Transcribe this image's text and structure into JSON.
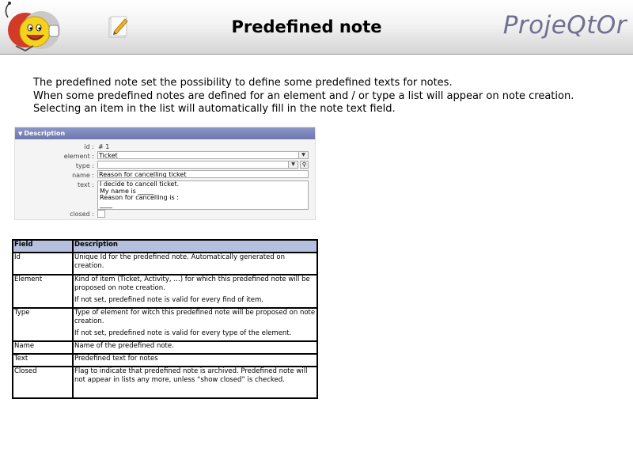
{
  "header": {
    "title": "Predefined note",
    "logo_text": "ProjeQtOr",
    "mascot_icon": "smiley-mascot-icon",
    "note_icon": "note-pencil-icon"
  },
  "intro": {
    "lines": [
      "The predefined note set the possibility to define some predefined texts for notes.",
      "When some predefined notes are defined for an element and / or type a list will appear on note creation.",
      "Selecting an item in the list will automatically fill in the note text field."
    ]
  },
  "form": {
    "section_title": "Description",
    "labels": {
      "id": "id :",
      "element": "element :",
      "type": "type :",
      "name": "name :",
      "text": "text :",
      "closed": "closed :"
    },
    "values": {
      "id": "# 1",
      "element": "Ticket",
      "type": "",
      "name": "Reason for cancelling ticket",
      "text_lines": [
        "I decide to cancell ticket.",
        "My name is _____",
        "Reason for cancelling is :",
        "____"
      ]
    }
  },
  "table": {
    "headers": [
      "Field",
      "Description"
    ],
    "rows": [
      {
        "field": "Id",
        "desc": [
          "Unique Id for the predefined note.  Automatically generated on creation."
        ]
      },
      {
        "field": "Element",
        "desc": [
          "Kind of item (Ticket, Activity, …) for which this predefined note will be proposed on note creation.",
          "If not set, predefined note is valid for every find of item."
        ]
      },
      {
        "field": "Type",
        "desc": [
          "Type of element for witch this predefined note will be proposed on note creation.",
          "If not set, predefined note is valid for every type of the element."
        ]
      },
      {
        "field": "Name",
        "desc": [
          "Name of the predefined note."
        ]
      },
      {
        "field": "Text",
        "desc": [
          "Predefined text for notes"
        ]
      },
      {
        "field": "Closed",
        "desc": [
          "Flag to indicate that predefined note is archived.  Predefined note will not appear in lists any more, unless “show closed” is checked."
        ]
      }
    ]
  }
}
